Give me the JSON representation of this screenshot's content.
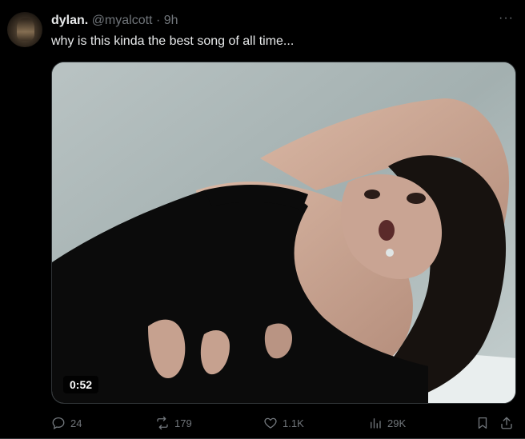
{
  "tweet": {
    "name": "dylan.",
    "handle": "@myalcott",
    "separator": "·",
    "time": "9h",
    "more": "···",
    "text": "why is this kinda the best song of all time...",
    "video_duration": "0:52"
  },
  "actions": {
    "replies": "24",
    "reposts": "179",
    "likes": "1.1K",
    "views": "29K"
  },
  "colors": {
    "background": "#000000",
    "text": "#e7e9ea",
    "muted": "#71767b"
  }
}
